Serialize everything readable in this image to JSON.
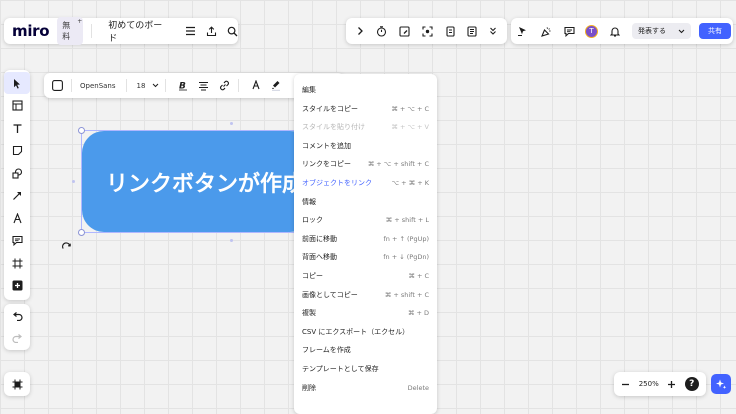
{
  "app": {
    "logo": "miro",
    "plan_badge": "無料",
    "plan_badge_mark": "+",
    "board_name": "初めてのボード"
  },
  "collab": {
    "present_label": "発表する",
    "share_label": "共有",
    "avatar_initial": "T"
  },
  "format_bar": {
    "font": "OpenSans",
    "size": "18"
  },
  "shape": {
    "text": "リンクボタンが作成",
    "fill": "#4b9aeb"
  },
  "context_menu": {
    "items": [
      {
        "label": "編集",
        "shortcut": "",
        "state": "normal"
      },
      {
        "label": "スタイルをコピー",
        "shortcut": "⌘ + ⌥ + C",
        "state": "normal"
      },
      {
        "label": "スタイルを貼り付け",
        "shortcut": "⌘ + ⌥ + V",
        "state": "disabled"
      },
      {
        "label": "コメントを追加",
        "shortcut": "",
        "state": "normal"
      },
      {
        "label": "リンクをコピー",
        "shortcut": "⌘ + ⌥ + shift + C",
        "state": "normal"
      },
      {
        "label": "オブジェクトをリンク",
        "shortcut": "⌥ + ⌘ + K",
        "state": "accent"
      },
      {
        "label": "情報",
        "shortcut": "",
        "state": "normal"
      },
      {
        "label": "ロック",
        "shortcut": "⌘ + shift + L",
        "state": "normal"
      },
      {
        "label": "前面に移動",
        "shortcut": "fn + ↑ (PgUp)",
        "state": "normal"
      },
      {
        "label": "背面へ移動",
        "shortcut": "fn + ↓ (PgDn)",
        "state": "normal"
      },
      {
        "label": "コピー",
        "shortcut": "⌘ + C",
        "state": "normal"
      },
      {
        "label": "画像としてコピー",
        "shortcut": "⌘ + shift + C",
        "state": "normal"
      },
      {
        "label": "複製",
        "shortcut": "⌘ + D",
        "state": "normal"
      },
      {
        "label": "CSV にエクスポート（エクセル）",
        "shortcut": "",
        "state": "normal"
      },
      {
        "label": "フレームを作成",
        "shortcut": "",
        "state": "normal"
      },
      {
        "label": "テンプレートとして保存",
        "shortcut": "",
        "state": "normal"
      },
      {
        "label": "削除",
        "shortcut": "Delete",
        "state": "normal"
      }
    ]
  },
  "zoom": {
    "level": "250%",
    "help": "?"
  },
  "colors": {
    "accent": "#4262ff",
    "canvas": "#f2f2f2"
  }
}
